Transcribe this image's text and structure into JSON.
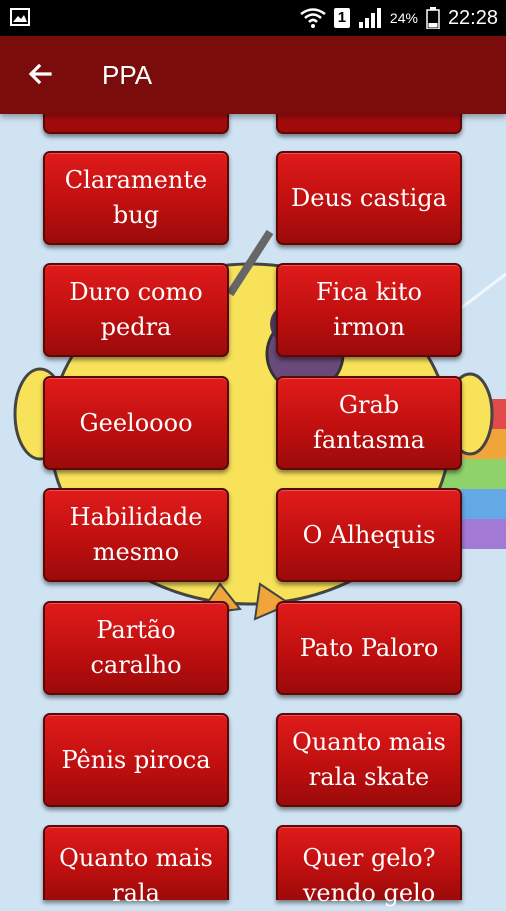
{
  "status_bar": {
    "battery_percent": "24%",
    "time": "22:28",
    "sim_label": "1",
    "icons": [
      "image-icon",
      "wifi-icon",
      "sim-icon",
      "signal-icon",
      "battery-icon"
    ]
  },
  "app_bar": {
    "title": "PPA",
    "back_icon": "arrow-back-icon",
    "color": "#7a0c0c"
  },
  "sound_buttons": [
    {
      "label": ""
    },
    {
      "label": ""
    },
    {
      "label": "Claramente bug"
    },
    {
      "label": "Deus castiga"
    },
    {
      "label": "Duro como pedra"
    },
    {
      "label": "Fica kito irmon"
    },
    {
      "label": "Geeloooo"
    },
    {
      "label": "Grab fantasma"
    },
    {
      "label": "Habilidade mesmo"
    },
    {
      "label": "O Alhequis"
    },
    {
      "label": "Partão caralho"
    },
    {
      "label": "Pato Paloro"
    },
    {
      "label": "Pênis piroca"
    },
    {
      "label": "Quanto mais rala skate"
    },
    {
      "label": "Quanto mais rala"
    },
    {
      "label": "Quer gelo? vendo gelo"
    }
  ],
  "colors": {
    "button_red": "#c00f0f",
    "sky": "#cfe3f3",
    "duck_yellow": "#f7e25a"
  }
}
